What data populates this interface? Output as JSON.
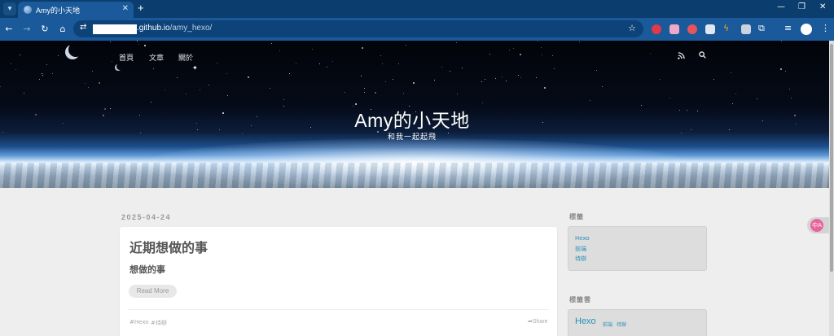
{
  "browser": {
    "tab_title": "Amy的小天地",
    "tab_close": "✕",
    "new_tab": "+",
    "url_domain": ".github.io",
    "url_path": "/amy_hexo/",
    "window_controls": [
      "—",
      "❐",
      "✕"
    ]
  },
  "nav": {
    "items": [
      {
        "label": "首頁"
      },
      {
        "label": "文章"
      },
      {
        "label": "關於"
      }
    ]
  },
  "hero": {
    "title": "Amy的小天地",
    "subtitle": "和我一起起飛"
  },
  "post": {
    "date": "2025-04-24",
    "title": "近期想做的事",
    "excerpt": "想做的事",
    "read_more": "Read More",
    "tags": [
      "#Hexo",
      "#待辦"
    ],
    "share": "Share"
  },
  "sidebar": {
    "tags_title": "標籤",
    "tags": [
      "Hexo",
      "前端",
      "待辦"
    ],
    "cloud_title": "標籤雲",
    "cloud": [
      {
        "label": "Hexo",
        "size": "large"
      },
      {
        "label": "前端",
        "size": "small"
      },
      {
        "label": "待辦",
        "size": "small"
      }
    ]
  },
  "translate_widget": {
    "label": "中A"
  },
  "colors": {
    "tabstrip": "#0b3d6e",
    "toolbar": "#1a5a9a",
    "link": "#258fb8",
    "page_bg": "#eeeeee"
  }
}
